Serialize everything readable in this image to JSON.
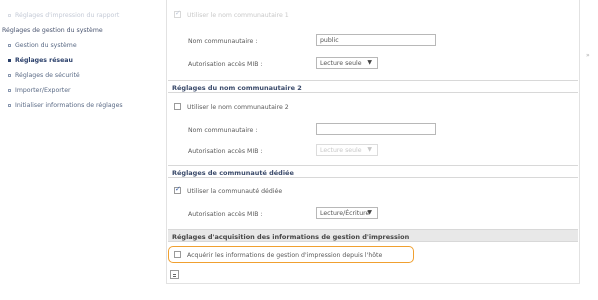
{
  "sidebar": {
    "faded_item": "Réglages d'impression du rapport",
    "root": "Réglages de gestion du système",
    "items": [
      {
        "label": "Gestion du système"
      },
      {
        "label": "Réglages réseau"
      },
      {
        "label": "Réglages de sécurité"
      },
      {
        "label": "Importer/Exporter"
      },
      {
        "label": "Initialiser informations de réglages"
      }
    ]
  },
  "top_section": {
    "checkbox_label": "Utiliser le nom communautaire 1",
    "name_label": "Nom communautaire :",
    "name_value": "public",
    "access_label": "Autorisation accès MIB :",
    "access_value": "Lecture seule"
  },
  "community2": {
    "header": "Réglages du nom communautaire 2",
    "checkbox_label": "Utiliser le nom communautaire 2",
    "name_label": "Nom communautaire :",
    "name_value": "",
    "access_label": "Autorisation accès MIB :",
    "access_value": "Lecture seule"
  },
  "dedicated": {
    "header": "Réglages de communauté dédiée",
    "checkbox_label": "Utiliser la communauté dédiée",
    "access_label": "Autorisation accès MIB :",
    "access_value": "Lecture/Écriture"
  },
  "acquisition": {
    "header": "Réglages d'acquisition des informations de gestion d'impression",
    "checkbox_label": "Acquérir les informations de gestion d'impression depuis l'hôte"
  },
  "icons": {
    "arrow_down": "▼",
    "right_arrow": "»"
  },
  "colors": {
    "highlight": "#f0a030",
    "header_text": "#3a4a6a"
  }
}
